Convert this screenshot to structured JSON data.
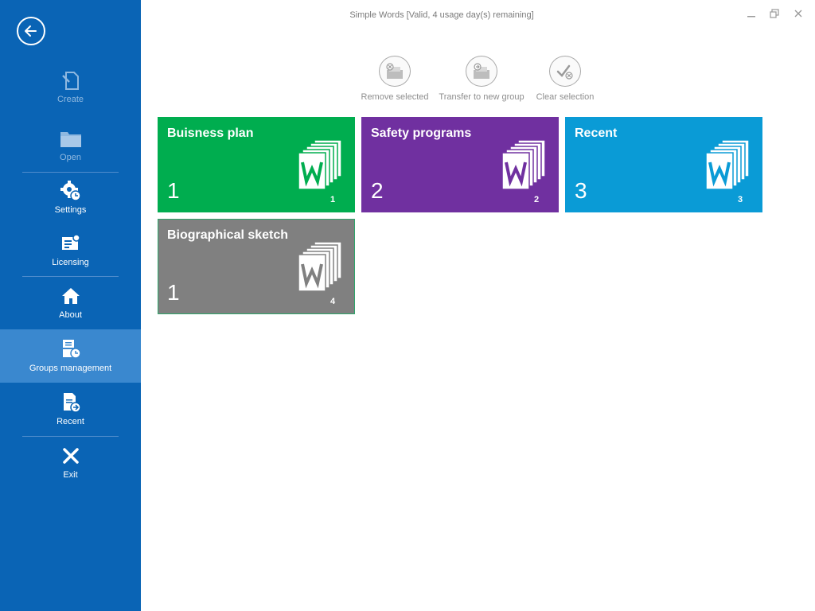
{
  "window": {
    "title": "Simple Words [Valid, 4 usage day(s) remaining]"
  },
  "sidebar": {
    "items": [
      {
        "label": "Create",
        "icon": "create-document-icon",
        "enabled": false
      },
      {
        "label": "Open",
        "icon": "folder-icon",
        "enabled": false
      },
      {
        "label": "Settings",
        "icon": "settings-gear-icon",
        "enabled": true
      },
      {
        "label": "Licensing",
        "icon": "license-icon",
        "enabled": true
      },
      {
        "label": "About",
        "icon": "home-icon",
        "enabled": true
      },
      {
        "label": "Groups management",
        "icon": "groups-management-icon",
        "enabled": true,
        "active": true
      },
      {
        "label": "Recent",
        "icon": "recent-documents-icon",
        "enabled": true
      },
      {
        "label": "Exit",
        "icon": "close-x-icon",
        "enabled": true
      }
    ]
  },
  "toolbar": {
    "remove_label": "Remove selected",
    "transfer_label": "Transfer to new group",
    "clear_label": "Clear selection"
  },
  "groups": [
    {
      "name": "Buisness plan",
      "count": "1",
      "doc_number": "1",
      "color": "#00ad4f"
    },
    {
      "name": "Safety programs",
      "count": "2",
      "doc_number": "2",
      "color": "#7030a0"
    },
    {
      "name": "Recent",
      "count": "3",
      "doc_number": "3",
      "color": "#0a9bd6"
    },
    {
      "name": "Biographical sketch",
      "count": "1",
      "doc_number": "4",
      "color": "#808080"
    }
  ],
  "colors": {
    "sidebar": "#0a64b5",
    "sidebar_active": "#3a88cf"
  }
}
